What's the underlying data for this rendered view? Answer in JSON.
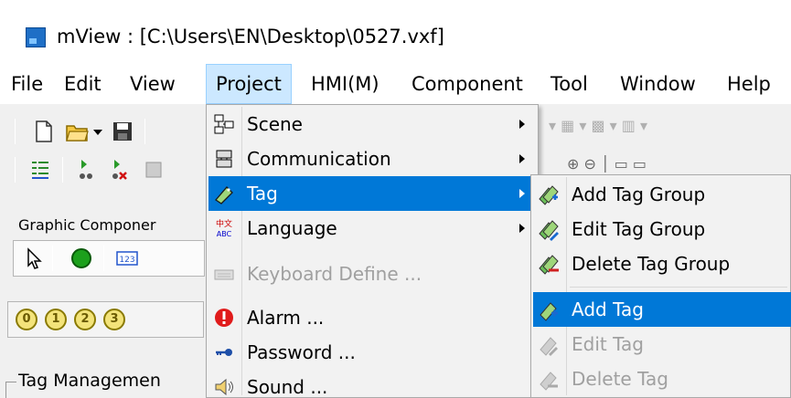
{
  "window": {
    "title": "mView : [C:\\Users\\EN\\Desktop\\0527.vxf]"
  },
  "menubar": {
    "items": [
      {
        "label": "File"
      },
      {
        "label": "Edit"
      },
      {
        "label": "View"
      },
      {
        "label": "Project"
      },
      {
        "label": "HMI(M)"
      },
      {
        "label": "Component"
      },
      {
        "label": "Tool"
      },
      {
        "label": "Window"
      },
      {
        "label": "Help"
      }
    ]
  },
  "left_panel": {
    "graphic_components_label": "Graphic Componer",
    "tag_management_label": "Tag Managemen",
    "number_buttons": [
      "0",
      "1",
      "2",
      "3"
    ]
  },
  "project_menu": {
    "items": [
      {
        "label": "Scene",
        "icon": "scene-icon",
        "submenu": true,
        "enabled": true
      },
      {
        "label": "Communication",
        "icon": "communication-icon",
        "submenu": true,
        "enabled": true
      },
      {
        "label": "Tag",
        "icon": "tag-icon",
        "submenu": true,
        "enabled": true,
        "highlighted": true
      },
      {
        "label": "Language",
        "icon": "language-icon",
        "submenu": true,
        "enabled": true
      },
      {
        "label": "Keyboard Define ...",
        "icon": "keyboard-icon",
        "submenu": false,
        "enabled": false
      },
      {
        "label": "Alarm ...",
        "icon": "alarm-icon",
        "submenu": false,
        "enabled": true
      },
      {
        "label": "Password ...",
        "icon": "password-icon",
        "submenu": false,
        "enabled": true
      },
      {
        "label": "Sound ...",
        "icon": "sound-icon",
        "submenu": false,
        "enabled": true
      }
    ]
  },
  "tag_submenu": {
    "items": [
      {
        "label": "Add Tag Group",
        "icon": "add-tag-group-icon",
        "enabled": true
      },
      {
        "label": "Edit Tag Group",
        "icon": "edit-tag-group-icon",
        "enabled": true
      },
      {
        "label": "Delete Tag Group",
        "icon": "delete-tag-group-icon",
        "enabled": true
      },
      {
        "label": "Add Tag",
        "icon": "add-tag-icon",
        "enabled": true,
        "highlighted": true
      },
      {
        "label": "Edit Tag",
        "icon": "edit-tag-icon",
        "enabled": false
      },
      {
        "label": "Delete Tag",
        "icon": "delete-tag-icon",
        "enabled": false
      }
    ]
  },
  "colors": {
    "highlight": "#0078d7",
    "menubar_active": "#cce8ff",
    "disabled_text": "#a0a0a0"
  }
}
